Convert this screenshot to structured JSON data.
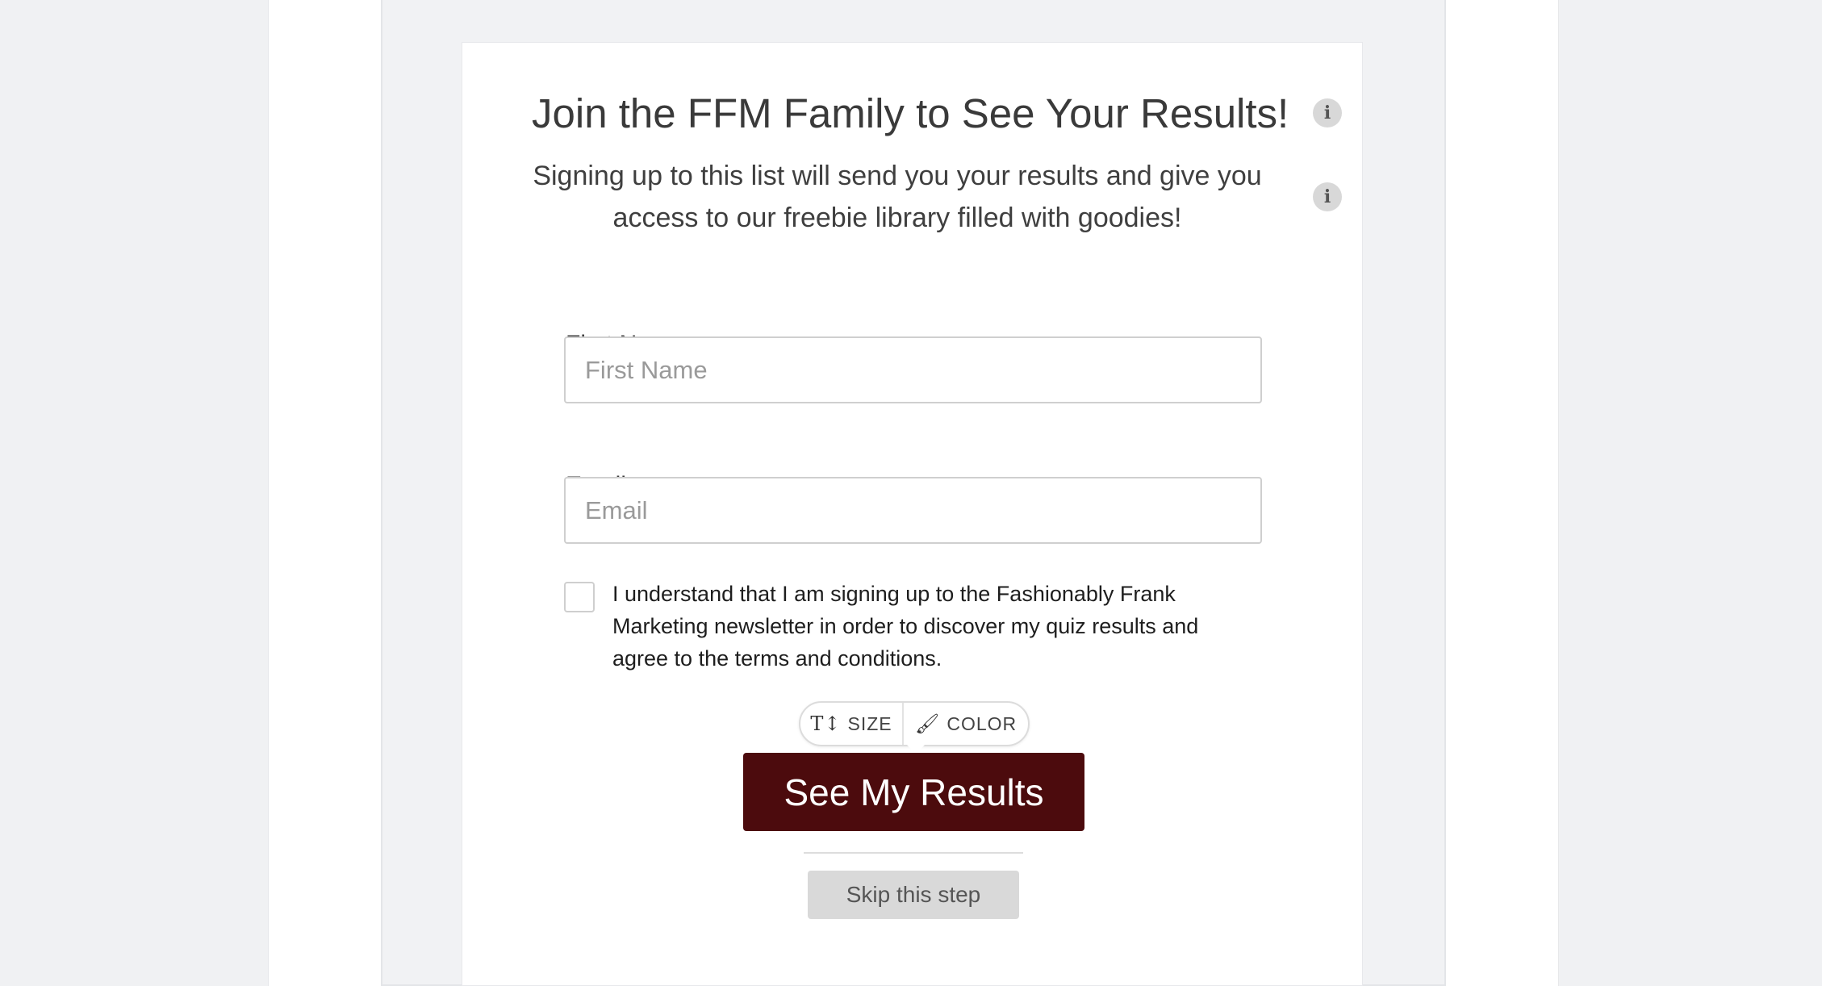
{
  "form": {
    "title": "Join the FFM Family to See Your Results!",
    "subtitle": "Signing up to this list will send you your results and give you access to our freebie library filled with goodies!",
    "fields": {
      "first_name": {
        "label": "First Name",
        "placeholder": "First Name",
        "value": ""
      },
      "email": {
        "label": "Email",
        "placeholder": "Email",
        "value": ""
      }
    },
    "consent": {
      "checked": false,
      "text": "I understand that I am signing up to the Fashionably Frank Marketing newsletter in order to discover my quiz results and agree to the terms and conditions."
    },
    "submit_label": "See My Results",
    "skip_label": "Skip this step"
  },
  "toolbar": {
    "size_label": "SIZE",
    "color_label": "COLOR",
    "size_icon": "text-size-icon",
    "color_icon": "paint-brush-icon"
  },
  "colors": {
    "button_primary": "#4c0b0d",
    "button_secondary": "#d9d9d9",
    "background": "#f1f2f4"
  }
}
